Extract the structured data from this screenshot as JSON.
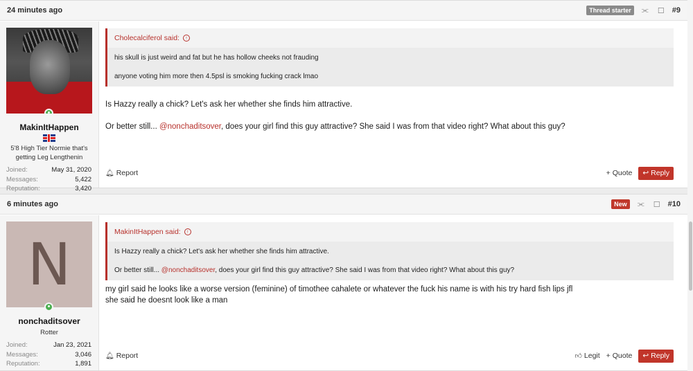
{
  "posts": [
    {
      "time": "24 minutes ago",
      "badge": "Thread starter",
      "number": "#9",
      "user": {
        "name": "MakinItHappen",
        "title": "5'8 High Tier Normie that's getting Leg Lengthenin",
        "stats": [
          {
            "label": "Joined:",
            "value": "May 31, 2020"
          },
          {
            "label": "Messages:",
            "value": "5,422"
          },
          {
            "label": "Reputation:",
            "value": "3,420"
          }
        ]
      },
      "quote": {
        "author_line": "Cholecalciferol said:",
        "lines": [
          "his skull is just weird and fat but he has hollow cheeks not frauding",
          "anyone voting him more then 4.5psl is smoking fucking crack lmao"
        ]
      },
      "message": {
        "line1": "Is Hazzy really a chick? Let's ask her whether she finds him attractive.",
        "line2_before": "Or better still... ",
        "mention": "@nonchaditsover",
        "line2_after": ", does your girl find this guy attractive? She said I was from that video right? What about this guy?"
      },
      "actions": {
        "report": "Report",
        "quote": "+ Quote",
        "reply": "Reply"
      }
    },
    {
      "time": "6 minutes ago",
      "badge": "New",
      "number": "#10",
      "user": {
        "name": "nonchaditsover",
        "avatar_letter": "N",
        "title": "Rotter",
        "stats": [
          {
            "label": "Joined:",
            "value": "Jan 23, 2021"
          },
          {
            "label": "Messages:",
            "value": "3,046"
          },
          {
            "label": "Reputation:",
            "value": "1,891"
          }
        ]
      },
      "quote": {
        "author_line": "MakinItHappen said:",
        "line1": "Is Hazzy really a chick? Let's ask her whether she finds him attractive.",
        "line2_before": "Or better still... ",
        "mention": "@nonchaditsover",
        "line2_after": ", does your girl find this guy attractive? She said I was from that video right? What about this guy?"
      },
      "message": {
        "line1": "my girl said he looks like a worse version (feminine) of timothee cahalete or whatever the fuck his name is with his try hard fish lips jfl",
        "line2": "she said he doesnt look like a man"
      },
      "actions": {
        "report": "Report",
        "legit": "Legit",
        "quote": "+ Quote",
        "reply": "Reply"
      }
    }
  ],
  "icons": {
    "share": "share-icon",
    "bookmark": "bookmark-icon",
    "bell": "bell-icon",
    "reply": "reply-arrow-icon",
    "thumbs_up": "thumbs-up-icon"
  },
  "colors": {
    "accent": "#c1352a",
    "badge_starter": "#8a8a8a",
    "online": "#4caf50"
  }
}
